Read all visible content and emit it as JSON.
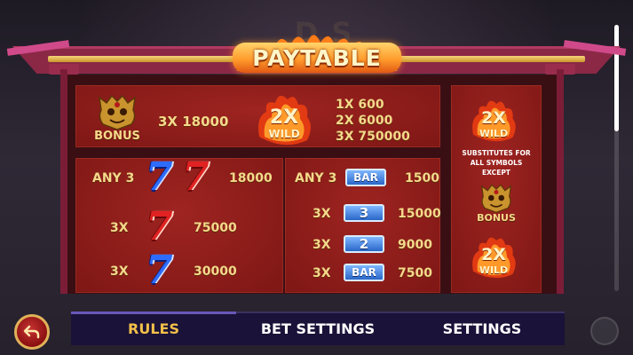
{
  "background_title": "D      S",
  "title": "PAYTABLE",
  "top_row": {
    "bonus_label": "BONUS",
    "bonus_pay": "3X  18000",
    "wild_multiplier": "2X",
    "wild_label": "WILD",
    "wild_pays": [
      "1X  600",
      "2X  6000",
      "3X  750000"
    ]
  },
  "sevens": {
    "any3_label": "ANY 3",
    "any3_pay": "18000",
    "red_count": "3X",
    "red_pay": "75000",
    "blue_count": "3X",
    "blue_pay": "30000",
    "glyph": "7"
  },
  "bars": {
    "any3_label": "ANY 3",
    "any3_pay": "1500",
    "bar_tile": "BAR",
    "triple_count": "3X",
    "triple_pay": "15000",
    "triple_glyph": "3",
    "double_count": "3X",
    "double_pay": "9000",
    "double_glyph": "2",
    "single_count": "3X",
    "single_pay": "7500"
  },
  "wild_info": {
    "multiplier": "2X",
    "label": "WILD",
    "description_1": "SUBSTITUTES FOR",
    "description_2": "ALL SYMBOLS",
    "description_3": "EXCEPT",
    "bonus_label": "BONUS",
    "multiplier_2": "2X",
    "label_2": "WILD"
  },
  "tabs": [
    {
      "label": "RULES",
      "active": true
    },
    {
      "label": "BET SETTINGS",
      "active": false
    },
    {
      "label": "SETTINGS",
      "active": false
    }
  ],
  "icons": {
    "back": "back-arrow-icon",
    "fire": "fire-icon",
    "mask": "bonus-mask-icon"
  },
  "colors": {
    "panel_red": "#8c1c1a",
    "roof": "#8b2846",
    "gold": "#f4d98b",
    "tab_active": "#f4c04a",
    "tab_bg": "#1a1238"
  }
}
